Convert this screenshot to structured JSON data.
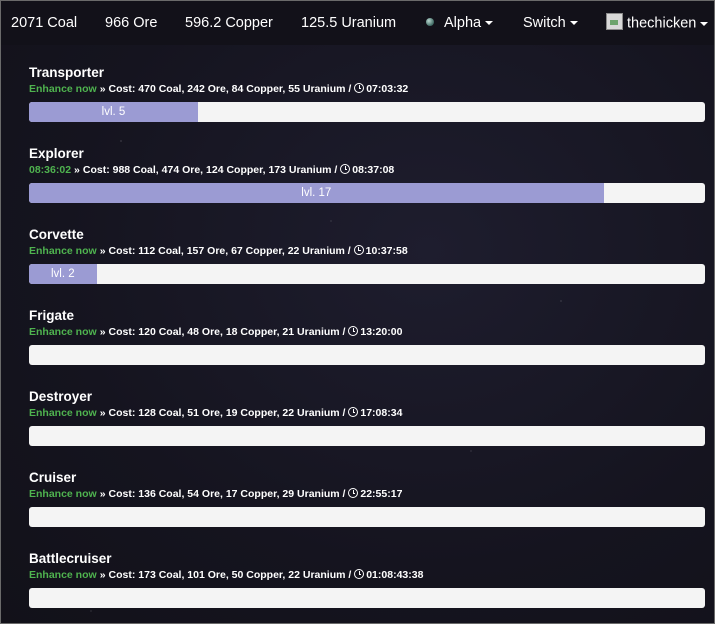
{
  "resources": {
    "coal": "2071 Coal",
    "ore": "966 Ore",
    "copper": "596.2 Copper",
    "uranium": "125.5 Uranium"
  },
  "nav": {
    "planet": "Alpha",
    "switch": "Switch",
    "user": "thechicken"
  },
  "ships": [
    {
      "name": "Transporter",
      "action": "Enhance now",
      "cost": "Cost: 470 Coal, 242 Ore, 84 Copper, 55 Uranium /",
      "time": "07:03:32",
      "level_label": "lvl. 5",
      "progress": 0.25
    },
    {
      "name": "Explorer",
      "action": "08:36:02",
      "cost": "Cost: 988 Coal, 474 Ore, 124 Copper, 173 Uranium /",
      "time": "08:37:08",
      "level_label": "lvl. 17",
      "progress": 0.85
    },
    {
      "name": "Corvette",
      "action": "Enhance now",
      "cost": "Cost: 112 Coal, 157 Ore, 67 Copper, 22 Uranium /",
      "time": "10:37:58",
      "level_label": "lvl. 2",
      "progress": 0.1
    },
    {
      "name": "Frigate",
      "action": "Enhance now",
      "cost": "Cost: 120 Coal, 48 Ore, 18 Copper, 21 Uranium /",
      "time": "13:20:00",
      "level_label": "",
      "progress": 0
    },
    {
      "name": "Destroyer",
      "action": "Enhance now",
      "cost": "Cost: 128 Coal, 51 Ore, 19 Copper, 22 Uranium /",
      "time": "17:08:34",
      "level_label": "",
      "progress": 0
    },
    {
      "name": "Cruiser",
      "action": "Enhance now",
      "cost": "Cost: 136 Coal, 54 Ore, 17 Copper, 29 Uranium /",
      "time": "22:55:17",
      "level_label": "",
      "progress": 0
    },
    {
      "name": "Battlecruiser",
      "action": "Enhance now",
      "cost": "Cost: 173 Coal, 101 Ore, 50 Copper, 22 Uranium /",
      "time": "01:08:43:38",
      "level_label": "",
      "progress": 0
    }
  ],
  "separator": "»",
  "colors": {
    "background": "#14131f",
    "navbar": "#121119",
    "enhance_link": "#4fb34f",
    "progress_fill": "#9b9bd3",
    "progress_track": "#f4f4f4"
  },
  "icons": {
    "planet": "planet-icon",
    "avatar": "avatar-icon",
    "clock": "clock-icon",
    "caret": "caret-down-icon"
  }
}
